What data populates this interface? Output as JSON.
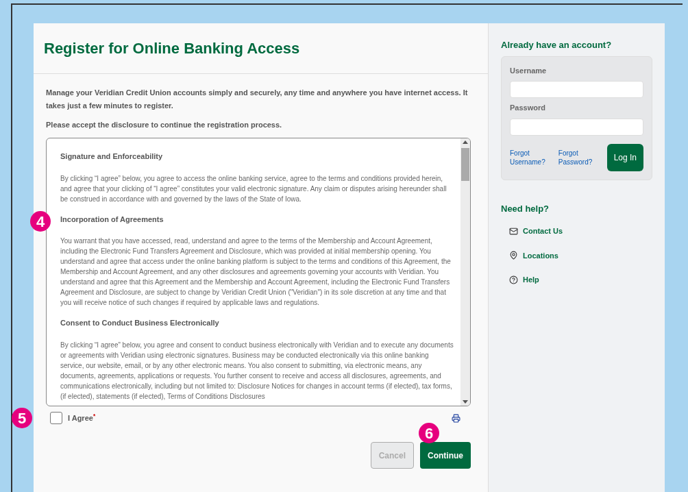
{
  "page": {
    "title": "Register for Online Banking Access",
    "intro": [
      "Manage your Veridian Credit Union accounts simply and securely, any time and anywhere you have internet access. It takes just a few minutes to register.",
      "Please accept the disclosure to continue the registration process."
    ],
    "disclosure": [
      {
        "heading": "Signature and Enforceability",
        "body": "By clicking “I agree” below, you agree to access the online banking service, agree to the terms and conditions provided herein, and agree that your clicking of “I agree” constitutes your valid electronic signature. Any claim or disputes arising hereunder shall be construed in accordance with and governed by the laws of the State of Iowa."
      },
      {
        "heading": "Incorporation of Agreements",
        "body": "You warrant that you have accessed, read, understand and agree to the terms of the Membership and Account Agreement, including the Electronic Fund Transfers Agreement and Disclosure, which was provided at initial membership opening. You understand and agree that access under the online banking platform is subject to the terms and conditions of this Agreement, the Membership and Account Agreement, and any other disclosures and agreements governing your accounts with Veridian. You understand and agree that this Agreement and the Membership and Account Agreement, including the Electronic Fund Transfers Agreement and Disclosure, are subject to change by Veridian Credit Union (\"Veridian\") in its sole discretion at any time and that you will receive notice of such changes if required by applicable laws and regulations."
      },
      {
        "heading": "Consent to Conduct Business Electronically",
        "body": "By clicking “I agree” below, you agree and consent to conduct business electronically with Veridian and to execute any documents or agreements with Veridian using electronic signatures. Business may be conducted electronically via this online banking service, our website, email, or by any other electronic means. You also consent to submitting, via electronic means, any documents, agreements, applications or requests. You further consent to receive and access all disclosures, agreements, and communications electronically, including but not limited to: Disclosure Notices for changes in account terms (if elected), tax forms, (if elected), statements (if elected), Terms of Conditions Disclosures"
      }
    ],
    "agree": {
      "label": "I Agree",
      "required_mark": "*",
      "checked": false
    },
    "buttons": [
      {
        "label": "Cancel",
        "kind": "secondary",
        "disabled": true
      },
      {
        "label": "Continue",
        "kind": "primary",
        "disabled": false
      }
    ]
  },
  "login": {
    "title": "Already have an account?",
    "username_label": "Username",
    "password_label": "Password",
    "links": [
      "Forgot Username?",
      "Forgot Password?"
    ],
    "button": "Log In"
  },
  "help": {
    "title": "Need help?",
    "items": [
      {
        "label": "Contact Us",
        "kind": "mail"
      },
      {
        "label": "Locations",
        "kind": "pin"
      },
      {
        "label": "Help",
        "kind": "question"
      }
    ]
  },
  "callouts": [
    {
      "label": "4",
      "kind": "disclosure"
    },
    {
      "label": "5",
      "kind": "agree"
    },
    {
      "label": "6",
      "kind": "continue"
    }
  ]
}
